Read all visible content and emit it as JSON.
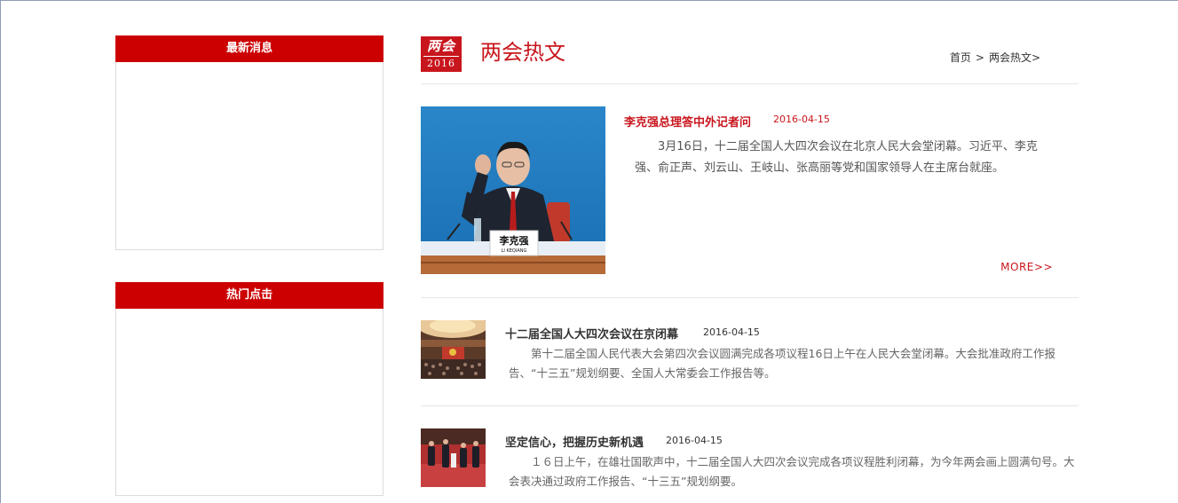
{
  "sidebar": {
    "latest": {
      "title": "最新消息"
    },
    "hot": {
      "title": "热门点击"
    }
  },
  "header": {
    "logo": {
      "top": "两会",
      "year": "2016"
    },
    "title": "两会热文",
    "breadcrumb": {
      "home": "首页",
      "separator": ">",
      "current": "两会热文>"
    }
  },
  "featured": {
    "title": "李克强总理答中外记者问",
    "date": "2016-04-15",
    "summary": "3月16日，十二届全国人大四次会议在北京人民大会堂闭幕。习近平、李克强、俞正声、刘云山、王岐山、张高丽等党和国家领导人在主席台就座。",
    "more": "MORE>>",
    "nameplate": {
      "name": "李克强",
      "pinyin": "LI KEQIANG"
    }
  },
  "articles": [
    {
      "title": "十二届全国人大四次会议在京闭幕",
      "date": "2016-04-15",
      "summary": "第十二届全国人民代表大会第四次会议圆满完成各项议程16日上午在人民大会堂闭幕。大会批准政府工作报告、“十三五”规划纲要、全国人大常委会工作报告等。"
    },
    {
      "title": "坚定信心，把握历史新机遇",
      "date": "2016-04-15",
      "summary": "１６日上午，在雄壮国歌声中，十二届全国人大四次会议完成各项议程胜利闭幕，为今年两会画上圆满句号。大会表决通过政府工作报告、“十三五”规划纲要。"
    }
  ],
  "colors": {
    "brand_red": "#cc0000",
    "title_red": "#c8161d",
    "border": "#dcdcdc"
  }
}
